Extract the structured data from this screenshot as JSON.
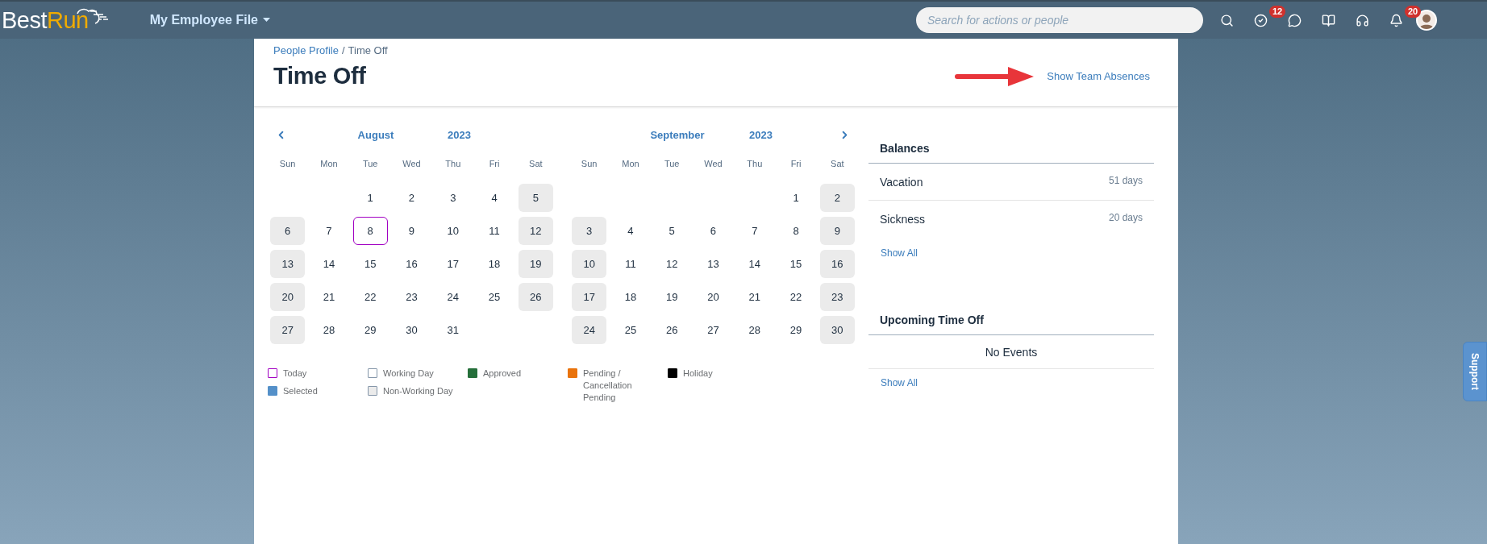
{
  "top_bar": {
    "logo": {
      "first": "Best",
      "second": "Run"
    },
    "menu": "My Employee File",
    "search": {
      "placeholder": "Search for actions or people"
    },
    "todo_badge": "12",
    "notification_badge": "20"
  },
  "header": {
    "breadcrumb": {
      "link": "People Profile",
      "separator": "/",
      "current": "Time Off"
    },
    "title": "Time Off",
    "team_link": "Show Team Absences"
  },
  "months": [
    {
      "month": "August",
      "year": "2023",
      "weekdays": [
        "Sun",
        "Mon",
        "Tue",
        "Wed",
        "Thu",
        "Fri",
        "Sat"
      ],
      "weeks": [
        [
          {
            "kind": "blank"
          },
          {
            "kind": "blank"
          },
          {
            "day": "1",
            "kind": "working"
          },
          {
            "day": "2",
            "kind": "working"
          },
          {
            "day": "3",
            "kind": "working"
          },
          {
            "day": "4",
            "kind": "working"
          },
          {
            "day": "5",
            "kind": "nonworking"
          }
        ],
        [
          {
            "day": "6",
            "kind": "nonworking"
          },
          {
            "day": "7",
            "kind": "working"
          },
          {
            "day": "8",
            "kind": "today"
          },
          {
            "day": "9",
            "kind": "working"
          },
          {
            "day": "10",
            "kind": "working"
          },
          {
            "day": "11",
            "kind": "working"
          },
          {
            "day": "12",
            "kind": "nonworking"
          }
        ],
        [
          {
            "day": "13",
            "kind": "nonworking"
          },
          {
            "day": "14",
            "kind": "working"
          },
          {
            "day": "15",
            "kind": "working"
          },
          {
            "day": "16",
            "kind": "working"
          },
          {
            "day": "17",
            "kind": "working"
          },
          {
            "day": "18",
            "kind": "working"
          },
          {
            "day": "19",
            "kind": "nonworking"
          }
        ],
        [
          {
            "day": "20",
            "kind": "nonworking"
          },
          {
            "day": "21",
            "kind": "working"
          },
          {
            "day": "22",
            "kind": "working"
          },
          {
            "day": "23",
            "kind": "working"
          },
          {
            "day": "24",
            "kind": "working"
          },
          {
            "day": "25",
            "kind": "working"
          },
          {
            "day": "26",
            "kind": "nonworking"
          }
        ],
        [
          {
            "day": "27",
            "kind": "nonworking"
          },
          {
            "day": "28",
            "kind": "working"
          },
          {
            "day": "29",
            "kind": "working"
          },
          {
            "day": "30",
            "kind": "working"
          },
          {
            "day": "31",
            "kind": "working"
          },
          {
            "kind": "blank"
          },
          {
            "kind": "blank"
          }
        ]
      ]
    },
    {
      "month": "September",
      "year": "2023",
      "weekdays": [
        "Sun",
        "Mon",
        "Tue",
        "Wed",
        "Thu",
        "Fri",
        "Sat"
      ],
      "weeks": [
        [
          {
            "kind": "blank"
          },
          {
            "kind": "blank"
          },
          {
            "kind": "blank"
          },
          {
            "kind": "blank"
          },
          {
            "kind": "blank"
          },
          {
            "day": "1",
            "kind": "working"
          },
          {
            "day": "2",
            "kind": "nonworking"
          }
        ],
        [
          {
            "day": "3",
            "kind": "nonworking"
          },
          {
            "day": "4",
            "kind": "working"
          },
          {
            "day": "5",
            "kind": "working"
          },
          {
            "day": "6",
            "kind": "working"
          },
          {
            "day": "7",
            "kind": "working"
          },
          {
            "day": "8",
            "kind": "working"
          },
          {
            "day": "9",
            "kind": "nonworking"
          }
        ],
        [
          {
            "day": "10",
            "kind": "nonworking"
          },
          {
            "day": "11",
            "kind": "working"
          },
          {
            "day": "12",
            "kind": "working"
          },
          {
            "day": "13",
            "kind": "working"
          },
          {
            "day": "14",
            "kind": "working"
          },
          {
            "day": "15",
            "kind": "working"
          },
          {
            "day": "16",
            "kind": "nonworking"
          }
        ],
        [
          {
            "day": "17",
            "kind": "nonworking"
          },
          {
            "day": "18",
            "kind": "working"
          },
          {
            "day": "19",
            "kind": "working"
          },
          {
            "day": "20",
            "kind": "working"
          },
          {
            "day": "21",
            "kind": "working"
          },
          {
            "day": "22",
            "kind": "working"
          },
          {
            "day": "23",
            "kind": "nonworking"
          }
        ],
        [
          {
            "day": "24",
            "kind": "nonworking"
          },
          {
            "day": "25",
            "kind": "working"
          },
          {
            "day": "26",
            "kind": "working"
          },
          {
            "day": "27",
            "kind": "working"
          },
          {
            "day": "28",
            "kind": "working"
          },
          {
            "day": "29",
            "kind": "working"
          },
          {
            "day": "30",
            "kind": "nonworking"
          }
        ]
      ]
    }
  ],
  "legend": [
    {
      "label": "Today",
      "kind": "outline",
      "color": "#a100c2"
    },
    {
      "label": "Working Day",
      "kind": "outline",
      "color": "#8496a9"
    },
    {
      "label": "Approved",
      "kind": "fill",
      "color": "#256f3a"
    },
    {
      "label": "Pending / Cancellation Pending",
      "kind": "fill",
      "color": "#e9730c"
    },
    {
      "label": "Holiday",
      "kind": "fill",
      "color": "#000000"
    },
    {
      "label": "Selected",
      "kind": "fill",
      "color": "#5490c9"
    },
    {
      "label": "Non-Working Day",
      "kind": "shaded",
      "color": "#8496a9"
    }
  ],
  "balances": {
    "title": "Balances",
    "rows": [
      {
        "name": "Vacation",
        "value": "51 days"
      },
      {
        "name": "Sickness",
        "value": "20 days"
      }
    ],
    "show_all": "Show All"
  },
  "upcoming": {
    "title": "Upcoming Time Off",
    "empty": "No Events",
    "show_all": "Show All"
  },
  "support_tab": "Support"
}
